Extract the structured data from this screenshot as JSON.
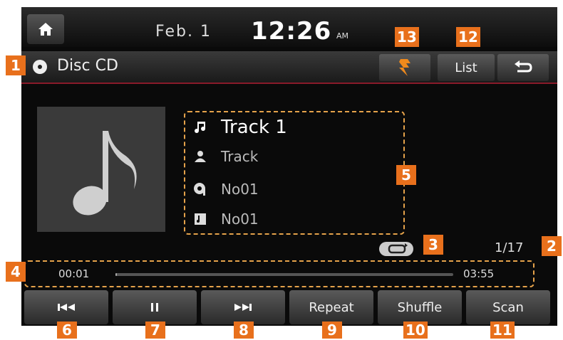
{
  "header": {
    "date": "Feb.  1",
    "time": "12:26",
    "ampm": "AM"
  },
  "source": {
    "label": "Disc CD",
    "list_label": "List"
  },
  "track": {
    "title": "Track 1",
    "artist": "Track",
    "album": "No01",
    "folder": "No01"
  },
  "status": {
    "track_count": "1/17"
  },
  "progress": {
    "elapsed": "00:01",
    "total": "03:55",
    "fraction": 0.004
  },
  "controls": {
    "repeat": "Repeat",
    "shuffle": "Shuffle",
    "scan": "Scan"
  },
  "callouts": {
    "c1": "1",
    "c2": "2",
    "c3": "3",
    "c4": "4",
    "c5": "5",
    "c6": "6",
    "c7": "7",
    "c8": "8",
    "c9": "9",
    "c10": "10",
    "c11": "11",
    "c12": "12",
    "c13": "13"
  },
  "colors": {
    "accent": "#e8701c",
    "dashed_outline": "#e5a24a",
    "sourcebar_underline": "#8a1a2a"
  }
}
